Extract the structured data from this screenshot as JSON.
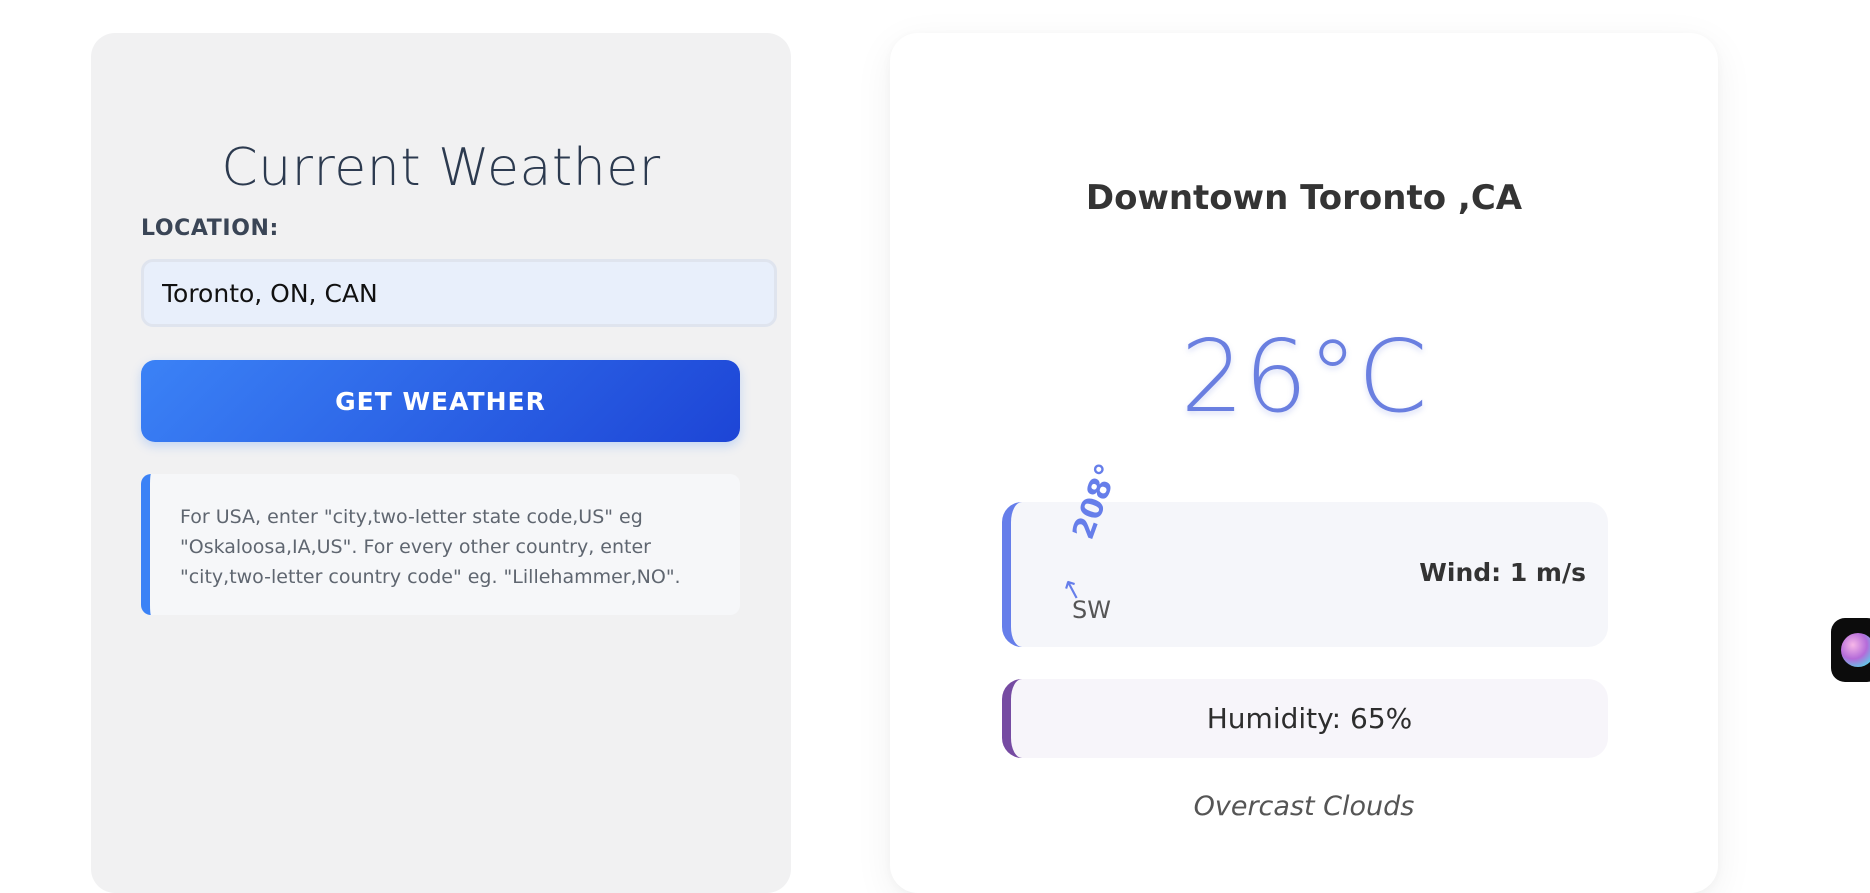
{
  "left_panel": {
    "title": "Current Weather",
    "location_label": "LOCATION:",
    "location_value": "Toronto, ON, CAN",
    "button_label": "GET WEATHER",
    "help_text": "For USA, enter \"city,two-letter state code,US\" eg \"Oskaloosa,IA,US\". For every other country, enter \"city,two-letter country code\" eg. \"Lillehammer,NO\"."
  },
  "weather": {
    "city": "Downtown Toronto ,CA",
    "temperature": "26°C",
    "wind_degrees": "208°",
    "wind_direction": "SW",
    "wind_speed": "Wind: 1 m/s",
    "humidity": "Humidity: 65%",
    "condition": "Overcast Clouds"
  },
  "icons": {
    "wind_arrow": "arrow-up-icon",
    "widget": "assistant-avatar-icon"
  },
  "colors": {
    "primary_button_start": "#3b82f6",
    "primary_button_end": "#1d45d6",
    "temperature": "#6a7fe0",
    "wind_accent": "#667eea",
    "humidity_accent": "#764ba2"
  }
}
